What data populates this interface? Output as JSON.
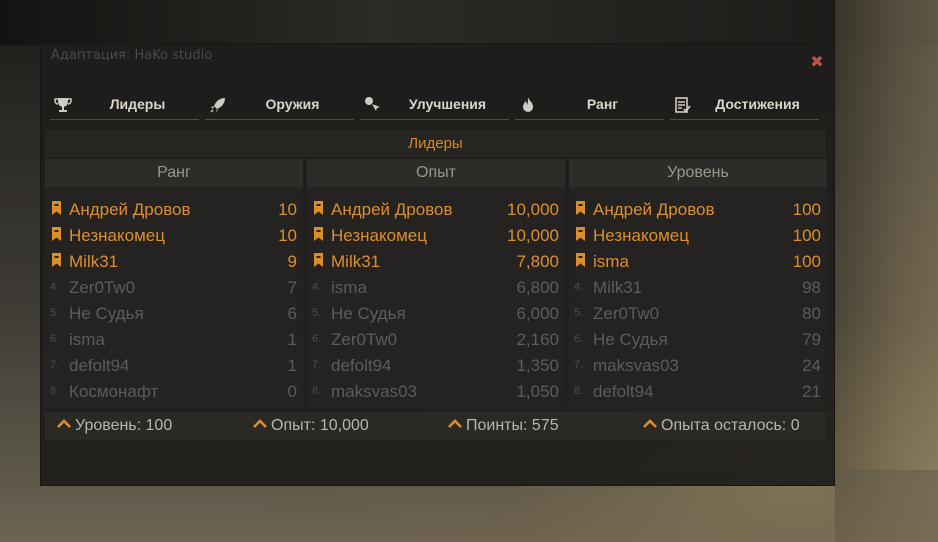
{
  "window": {
    "title": "Адаптация: HaKo studio",
    "close_icon": "close-icon"
  },
  "tabs": [
    {
      "label": "Лидеры",
      "icon": "trophy-icon"
    },
    {
      "label": "Оружия",
      "icon": "rocket-icon"
    },
    {
      "label": "Улучшения",
      "icon": "cursor-upgrade-icon"
    },
    {
      "label": "Ранг",
      "icon": "flame-icon"
    },
    {
      "label": "Достижения",
      "icon": "checklist-icon"
    }
  ],
  "section": {
    "title": "Лидеры"
  },
  "columns": [
    {
      "title": "Ранг",
      "rows": [
        {
          "rank": "",
          "name": "Андрей Дровов",
          "value": "10"
        },
        {
          "rank": "",
          "name": "Незнакомец",
          "value": "10"
        },
        {
          "rank": "",
          "name": "Milk31",
          "value": "9"
        },
        {
          "rank": "4.",
          "name": "Zer0Tw0",
          "value": "7"
        },
        {
          "rank": "5.",
          "name": "Не Судья",
          "value": "6"
        },
        {
          "rank": "6.",
          "name": "isma",
          "value": "1"
        },
        {
          "rank": "7.",
          "name": "defolt94",
          "value": "1"
        },
        {
          "rank": "8.",
          "name": "Космонафт",
          "value": "0"
        }
      ]
    },
    {
      "title": "Опыт",
      "rows": [
        {
          "rank": "",
          "name": "Андрей Дровов",
          "value": "10,000"
        },
        {
          "rank": "",
          "name": "Незнакомец",
          "value": "10,000"
        },
        {
          "rank": "",
          "name": "Milk31",
          "value": "7,800"
        },
        {
          "rank": "4.",
          "name": "isma",
          "value": "6,800"
        },
        {
          "rank": "5.",
          "name": "Не Судья",
          "value": "6,000"
        },
        {
          "rank": "6.",
          "name": "Zer0Tw0",
          "value": "2,160"
        },
        {
          "rank": "7.",
          "name": "defolt94",
          "value": "1,350"
        },
        {
          "rank": "8.",
          "name": "maksvas03",
          "value": "1,050"
        }
      ]
    },
    {
      "title": "Уровень",
      "rows": [
        {
          "rank": "",
          "name": "Андрей Дровов",
          "value": "100"
        },
        {
          "rank": "",
          "name": "Незнакомец",
          "value": "100"
        },
        {
          "rank": "",
          "name": "isma",
          "value": "100"
        },
        {
          "rank": "4.",
          "name": "Milk31",
          "value": "98"
        },
        {
          "rank": "5.",
          "name": "Zer0Tw0",
          "value": "80"
        },
        {
          "rank": "6.",
          "name": "Не Судья",
          "value": "79"
        },
        {
          "rank": "7.",
          "name": "maksvas03",
          "value": "24"
        },
        {
          "rank": "8.",
          "name": "defolt94",
          "value": "21"
        }
      ]
    }
  ],
  "footer": {
    "level": "Уровень: 100",
    "experience": "Опыт: 10,000",
    "points": "Поинты: 575",
    "exp_left": "Опыта осталось: 0"
  },
  "colors": {
    "accent": "#dd8e2c",
    "close": "#c0504a",
    "muted": "#5e5c57"
  }
}
